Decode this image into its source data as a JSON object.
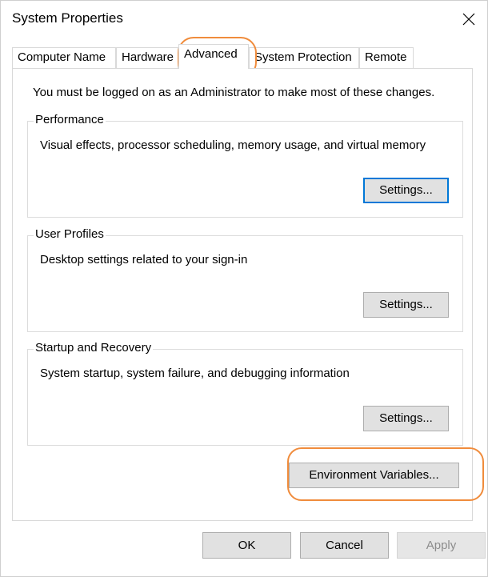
{
  "window": {
    "title": "System Properties"
  },
  "icons": {
    "close": "close-icon"
  },
  "tabs": [
    {
      "label": "Computer Name"
    },
    {
      "label": "Hardware"
    },
    {
      "label": "Advanced",
      "active": true
    },
    {
      "label": "System Protection"
    },
    {
      "label": "Remote"
    }
  ],
  "main": {
    "admin_note": "You must be logged on as an Administrator to make most of these changes.",
    "groups": {
      "performance": {
        "title": "Performance",
        "description": "Visual effects, processor scheduling, memory usage, and virtual memory",
        "button": "Settings..."
      },
      "user_profiles": {
        "title": "User Profiles",
        "description": "Desktop settings related to your sign-in",
        "button": "Settings..."
      },
      "startup_recovery": {
        "title": "Startup and Recovery",
        "description": "System startup, system failure, and debugging information",
        "button": "Settings..."
      }
    },
    "env_button": "Environment Variables..."
  },
  "footer": {
    "ok": "OK",
    "cancel": "Cancel",
    "apply": "Apply"
  },
  "colors": {
    "highlight": "#f08c3c",
    "default_button_border": "#0078d7",
    "button_face": "#e1e1e1"
  }
}
